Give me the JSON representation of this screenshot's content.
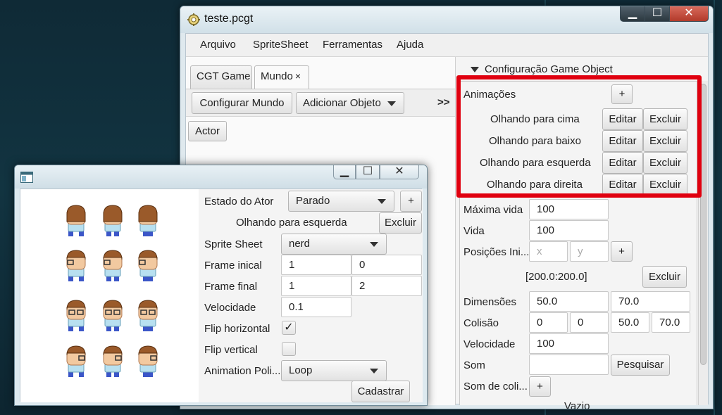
{
  "main_window": {
    "title": "teste.pcgt",
    "controls": {
      "minimize": "▁",
      "maximize": "☐",
      "close": "✕"
    },
    "menu": [
      "Arquivo",
      "SpriteSheet",
      "Ferramentas",
      "Ajuda"
    ],
    "tabs": [
      {
        "label": "CGT Game"
      },
      {
        "label": "Mundo",
        "close": "×"
      }
    ],
    "toolbar": {
      "configure_label": "Configurar Mundo",
      "add_object_label": "Adicionar Objeto",
      "overflow": ">>"
    },
    "objects": [
      "Actor"
    ],
    "inspector": {
      "section_title": "Configuração Game Object",
      "animations_label": "Animações",
      "add_label": "+",
      "animations": [
        {
          "name": "Olhando para cima",
          "edit": "Editar",
          "delete": "Excluir"
        },
        {
          "name": "Olhando para baixo",
          "edit": "Editar",
          "delete": "Excluir"
        },
        {
          "name": "Olhando para esquerda",
          "edit": "Editar",
          "delete": "Excluir"
        },
        {
          "name": "Olhando para direita",
          "edit": "Editar",
          "delete": "Excluir"
        }
      ],
      "max_life_label": "Máxima vida",
      "max_life_value": "100",
      "life_label": "Vida",
      "life_value": "100",
      "positions_label": "Posições Ini...",
      "x_placeholder": "x",
      "y_placeholder": "y",
      "positions_add": "+",
      "position_entry": "[200.0:200.0]",
      "position_delete": "Excluir",
      "dimensions_label": "Dimensões",
      "dimensions_w": "50.0",
      "dimensions_h": "70.0",
      "collision_label": "Colisão",
      "collision": [
        "0",
        "0",
        "50.0",
        "70.0"
      ],
      "speed_label": "Velocidade",
      "speed_value": "100",
      "sound_label": "Som",
      "sound_value": "",
      "search_label": "Pesquisar",
      "collision_sound_label": "Som de coli...",
      "collision_sound_add": "+",
      "empty_label": "Vazio"
    }
  },
  "animation_window": {
    "controls": {
      "minimize": "▁",
      "maximize": "☐",
      "close": "✕"
    },
    "actor_state_label": "Estado do Ator",
    "actor_state_value": "Parado",
    "actor_state_add": "+",
    "animation_name": "Olhando para esquerda",
    "animation_delete": "Excluir",
    "sprite_sheet_label": "Sprite Sheet",
    "sprite_sheet_value": "nerd",
    "frame_start_label": "Frame inical",
    "frame_start": [
      "1",
      "0"
    ],
    "frame_end_label": "Frame final",
    "frame_end": [
      "1",
      "2"
    ],
    "speed_label": "Velocidade",
    "speed_value": "0.1",
    "flip_h_label": "Flip horizontal",
    "flip_h_checked": true,
    "flip_h_mark": "✓",
    "flip_v_label": "Flip vertical",
    "flip_v_checked": false,
    "policy_label": "Animation Poli...",
    "policy_value": "Loop",
    "register_label": "Cadastrar",
    "sprite_rows": [
      {
        "direction": "back"
      },
      {
        "direction": "left"
      },
      {
        "direction": "front"
      },
      {
        "direction": "right"
      }
    ]
  },
  "colors": {
    "highlight": "#e0000f",
    "desktop": "#123441",
    "shirt": "#b8e0f0",
    "pants": "#3b56c8",
    "hair": "#9a5a2a"
  }
}
